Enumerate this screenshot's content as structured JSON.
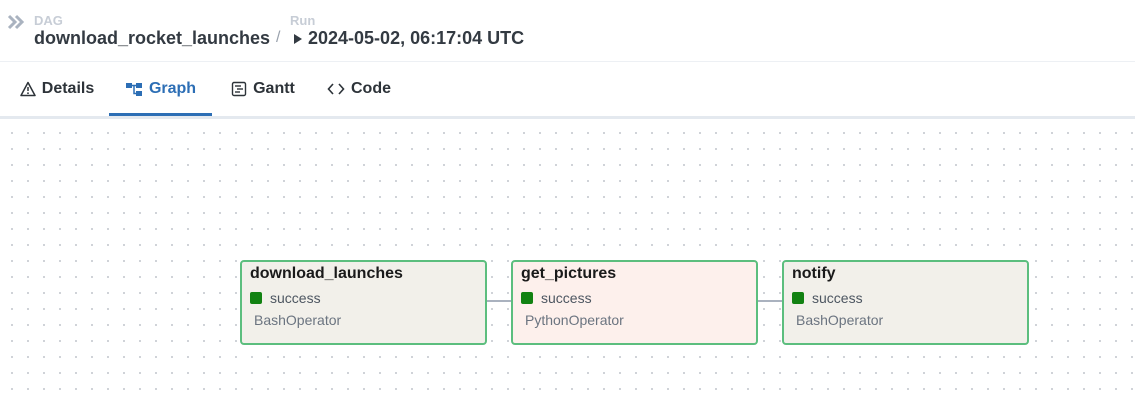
{
  "breadcrumb": {
    "dag_label": "DAG",
    "dag_name": "download_rocket_launches",
    "separator": "/",
    "run_label": "Run",
    "run_value": "2024-05-02, 06:17:04 UTC"
  },
  "tabs": [
    {
      "label": "Details",
      "icon": "warning-triangle-icon"
    },
    {
      "label": "Graph",
      "icon": "graph-icon",
      "active": true
    },
    {
      "label": "Gantt",
      "icon": "gantt-icon"
    },
    {
      "label": "Code",
      "icon": "code-icon"
    }
  ],
  "graph": {
    "nodes": [
      {
        "id": "download_launches",
        "status": "success",
        "operator": "BashOperator"
      },
      {
        "id": "get_pictures",
        "status": "success",
        "operator": "PythonOperator"
      },
      {
        "id": "notify",
        "status": "success",
        "operator": "BashOperator"
      }
    ],
    "edges": [
      [
        "download_launches",
        "get_pictures"
      ],
      [
        "get_pictures",
        "notify"
      ]
    ]
  },
  "colors": {
    "accent": "#2c6eb5",
    "success": "#128212",
    "node_border": "#5cbe7e",
    "bash_bg": "#f2f0ea",
    "python_bg": "#fdf0ec"
  }
}
